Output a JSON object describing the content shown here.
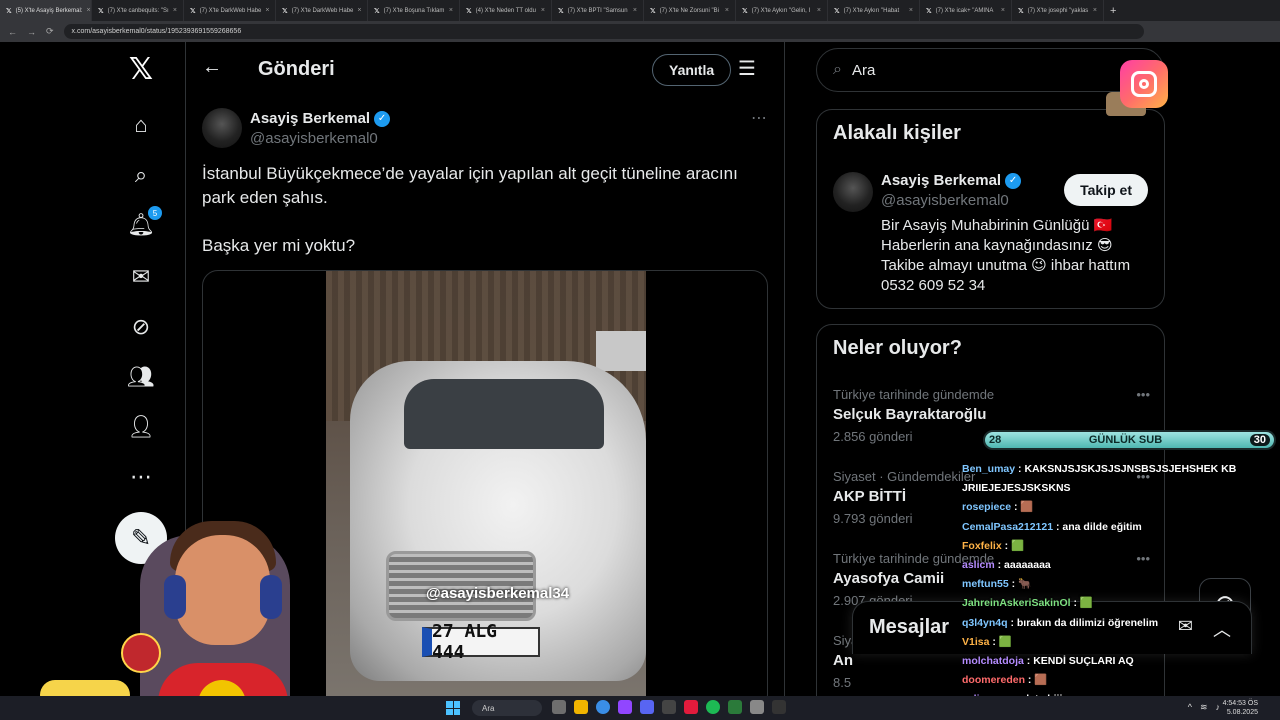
{
  "browser": {
    "tabs": [
      "(5) X'te Asayiş Berkemal:",
      "(7) X'te canbequits: \"Sı",
      "(7) X'te DarkWeb Habe",
      "(7) X'te DarkWeb Habe",
      "(7) X'te Boşuna Tıklam",
      "(4) X'te Neden TT oldu",
      "(7) X'te BPTI \"Samsun",
      "(7) X'te Ne Zorsuni \"Bi",
      "(7) X'te Aykırı \"Gelin, I",
      "(7) X'te Aykırı \"Habat",
      "(7) X'te icak+ \"AMINA",
      "(7) X'te josephi \"yaklas"
    ],
    "url": "x.com/asayisberkemal0/status/1952393691559268656"
  },
  "nav": {
    "notifications_badge": "5"
  },
  "header": {
    "title": "Gönderi",
    "reply_label": "Yanıtla"
  },
  "tweet": {
    "author_name": "Asayiş Berkemal",
    "author_handle": "@asayisberkemal0",
    "text_line1": "İstanbul Büyükçekmece’de yayalar için yapılan alt geçit tüneline aracını park eden şahıs.",
    "text_line2": "Başka yer mi yoktu?",
    "video_watermark": "@asayisberkemal34",
    "plate": "27 ALG 444"
  },
  "search": {
    "placeholder": "Ara"
  },
  "related": {
    "title": "Alakalı kişiler",
    "name": "Asayiş Berkemal",
    "handle": "@asayisberkemal0",
    "follow_label": "Takip et",
    "bio": "Bir Asayiş Muhabirinin Günlüğü 🇹🇷 Haberlerin ana kaynağındasınız 😎 Takibe almayı unutma 😉 ihbar hattım 0532 609 52 34"
  },
  "trends": {
    "title": "Neler oluyor?",
    "items": [
      {
        "context": "Türkiye tarihinde gündemde",
        "name": "Selçuk Bayraktaroğlu",
        "count": "2.856 gönderi"
      },
      {
        "context": "Siyaset · Gündemdekiler",
        "name": "AKP BİTTİ",
        "count": "9.793 gönderi"
      },
      {
        "context": "Türkiye tarihinde gündemde",
        "name": "Ayasofya Camii",
        "count": "2.907 gönderi"
      },
      {
        "context": "Siyaset · Gündemdekiler",
        "name": "An",
        "count": "8.5"
      }
    ]
  },
  "messages": {
    "title": "Mesajlar"
  },
  "overlay": {
    "sub_start": "28",
    "sub_label": "GÜNLÜK SUB",
    "sub_end": "30",
    "sub_progress": 0.93,
    "chat": [
      {
        "user": "Ben_umay",
        "msg": "KAKSNJSJSKJSJSJNSBSJSJEHSHEK KB",
        "color": "b"
      },
      {
        "user": "",
        "msg": "JRIIEJEJESJSKSKNS",
        "color": ""
      },
      {
        "user": "rosepiece",
        "msg": "🟫",
        "color": "b"
      },
      {
        "user": "CemalPasa212121",
        "msg": "ana dilde eğitim",
        "color": "b"
      },
      {
        "user": "Foxfelix",
        "msg": "🟩",
        "color": "o"
      },
      {
        "user": "aslicm",
        "msg": "aaaaaaaa",
        "color": ""
      },
      {
        "user": "meftun55",
        "msg": "🐂",
        "color": "b"
      },
      {
        "user": "JahreinAskeriSakinOl",
        "msg": "🟩",
        "color": "g"
      },
      {
        "user": "q3l4yn4q",
        "msg": "bırakın da dilimizi öğrenelim",
        "color": "b"
      },
      {
        "user": "V1isa",
        "msg": "🟩",
        "color": "o"
      },
      {
        "user": "molchatdoja",
        "msg": "KENDİ SUÇLARI AQ",
        "color": ""
      },
      {
        "user": "doomereden",
        "msg": "🟫",
        "color": "r"
      },
      {
        "user": "aslicm",
        "msg": "mpolat abiii",
        "color": ""
      }
    ]
  },
  "taskbar": {
    "search": "Ara",
    "time": "4:54:53 ÖS",
    "date": "5.08.2025"
  }
}
